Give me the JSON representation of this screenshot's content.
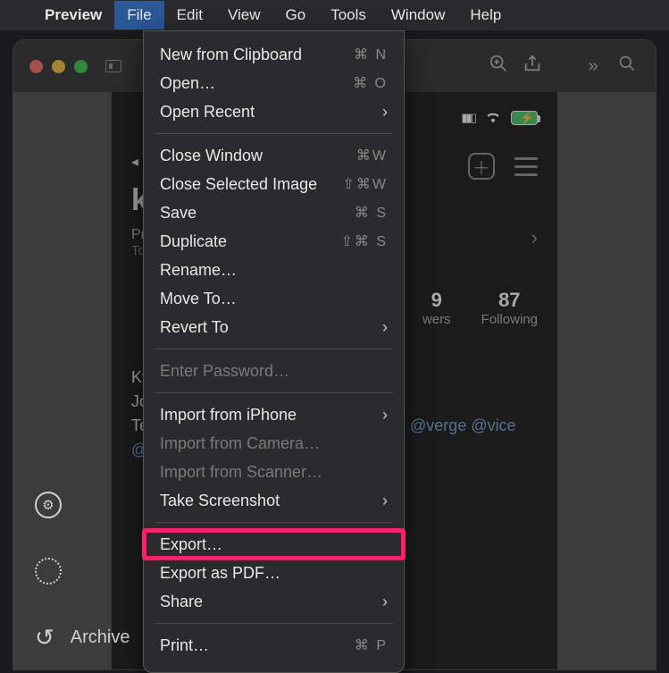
{
  "menubar": {
    "app": "Preview",
    "items": [
      "File",
      "Edit",
      "View",
      "Go",
      "Tools",
      "Window",
      "Help"
    ],
    "active_index": 0
  },
  "dropdown": [
    {
      "label": "New from Clipboard",
      "shortcut": "⌘ N",
      "type": "item"
    },
    {
      "label": "Open…",
      "shortcut": "⌘ O",
      "type": "item"
    },
    {
      "label": "Open Recent",
      "submenu": true,
      "type": "item"
    },
    {
      "type": "sep"
    },
    {
      "label": "Close Window",
      "shortcut": "⌘W",
      "type": "item"
    },
    {
      "label": "Close Selected Image",
      "shortcut": "⇧⌘W",
      "type": "item"
    },
    {
      "label": "Save",
      "shortcut": "⌘ S",
      "type": "item"
    },
    {
      "label": "Duplicate",
      "shortcut": "⇧⌘ S",
      "type": "item"
    },
    {
      "label": "Rename…",
      "type": "item"
    },
    {
      "label": "Move To…",
      "type": "item"
    },
    {
      "label": "Revert To",
      "submenu": true,
      "type": "item"
    },
    {
      "type": "sep"
    },
    {
      "label": "Enter Password…",
      "disabled": true,
      "type": "item"
    },
    {
      "type": "sep"
    },
    {
      "label": "Import from iPhone",
      "submenu": true,
      "type": "item"
    },
    {
      "label": "Import from Camera…",
      "disabled": true,
      "type": "item"
    },
    {
      "label": "Import from Scanner…",
      "disabled": true,
      "type": "item"
    },
    {
      "label": "Take Screenshot",
      "submenu": true,
      "type": "item"
    },
    {
      "type": "sep"
    },
    {
      "label": "Export…",
      "type": "item",
      "highlight": true
    },
    {
      "label": "Export as PDF…",
      "type": "item"
    },
    {
      "label": "Share",
      "submenu": true,
      "type": "item"
    },
    {
      "type": "sep"
    },
    {
      "label": "Print…",
      "shortcut": "⌘ P",
      "type": "item"
    }
  ],
  "titlebar": {},
  "phone": {
    "back": "◂ Se",
    "handle_partial": "kw",
    "sub1": "Pro",
    "sub2": "Too",
    "stat1_num": "9",
    "stat1_lbl": "wers",
    "stat2_num": "87",
    "stat2_lbl": "Following",
    "bio1": "Kyl",
    "bio2": "Jou",
    "bio3": "Tec",
    "bio4": "@k",
    "bio_right": "ds @verge @vice"
  },
  "sidebar": {
    "archive": "Archive"
  }
}
